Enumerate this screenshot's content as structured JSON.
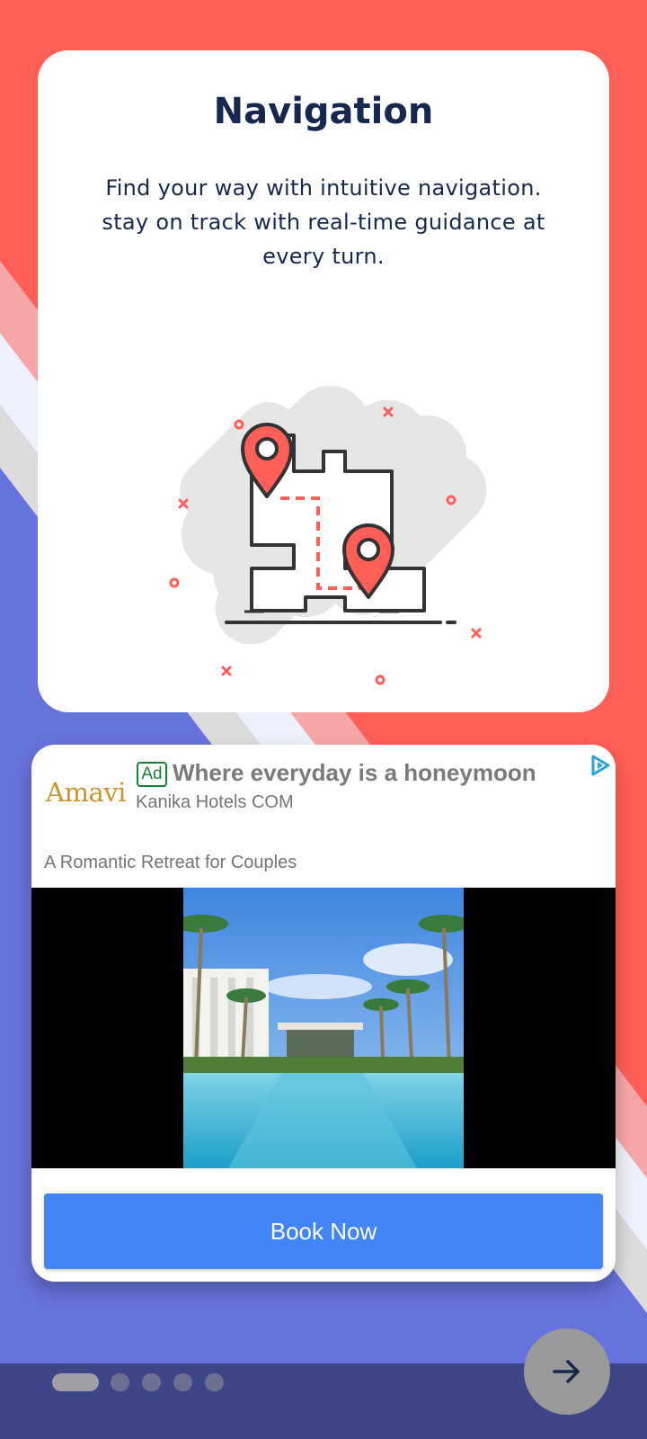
{
  "onboarding": {
    "title": "Navigation",
    "description": "Find your way with intuitive navigation. stay on track with real-time guidance at every turn.",
    "illustration_icon": "map-route-icon"
  },
  "ad": {
    "logo_text": "Amavi",
    "badge": "Ad",
    "headline": "Where everyday is a honeymoon",
    "advertiser": "Kanika Hotels COM",
    "body": "A Romantic Retreat for Couples",
    "cta_label": "Book Now",
    "choices_icon": "adchoices-icon"
  },
  "pager": {
    "total": 5,
    "active_index": 0
  },
  "next_icon": "arrow-right-icon",
  "colors": {
    "coral": "#ff5f57",
    "indigo": "#6773dc",
    "navy_text": "#17284f",
    "cta_blue": "#4285f4",
    "bottom_bar": "#3c4585"
  }
}
